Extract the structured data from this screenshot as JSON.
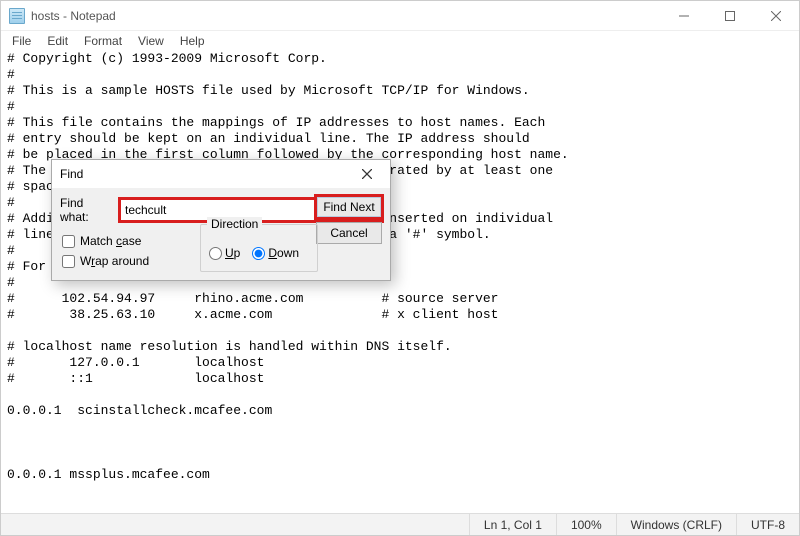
{
  "window": {
    "title": "hosts - Notepad"
  },
  "menubar": {
    "file": "File",
    "edit": "Edit",
    "format": "Format",
    "view": "View",
    "help": "Help"
  },
  "editor": {
    "content": "# Copyright (c) 1993-2009 Microsoft Corp.\n#\n# This is a sample HOSTS file used by Microsoft TCP/IP for Windows.\n#\n# This file contains the mappings of IP addresses to host names. Each\n# entry should be kept on an individual line. The IP address should\n# be placed in the first column followed by the corresponding host name.\n# The IP address and the host name should be separated by at least one\n# space.\n#\n# Additionally, comments (such as these) may be inserted on individual\n# lines or following the machine name denoted by a '#' symbol.\n#\n# For example:\n#\n#      102.54.94.97     rhino.acme.com          # source server\n#       38.25.63.10     x.acme.com              # x client host\n\n# localhost name resolution is handled within DNS itself.\n#       127.0.0.1       localhost\n#       ::1             localhost\n\n0.0.0.1  scinstallcheck.mcafee.com\n\n\n\n0.0.0.1 mssplus.mcafee.com"
  },
  "find": {
    "title": "Find",
    "label_find_what": "Find what:",
    "value": "techcult",
    "btn_find_next": "Find Next",
    "btn_cancel": "Cancel",
    "direction_legend": "Direction",
    "radio_up": "Up",
    "radio_down": "Down",
    "direction_selected": "down",
    "chk_match_case": "Match case",
    "chk_wrap_around": "Wrap around"
  },
  "statusbar": {
    "position": "Ln 1, Col 1",
    "zoom": "100%",
    "eol": "Windows (CRLF)",
    "encoding": "UTF-8"
  }
}
